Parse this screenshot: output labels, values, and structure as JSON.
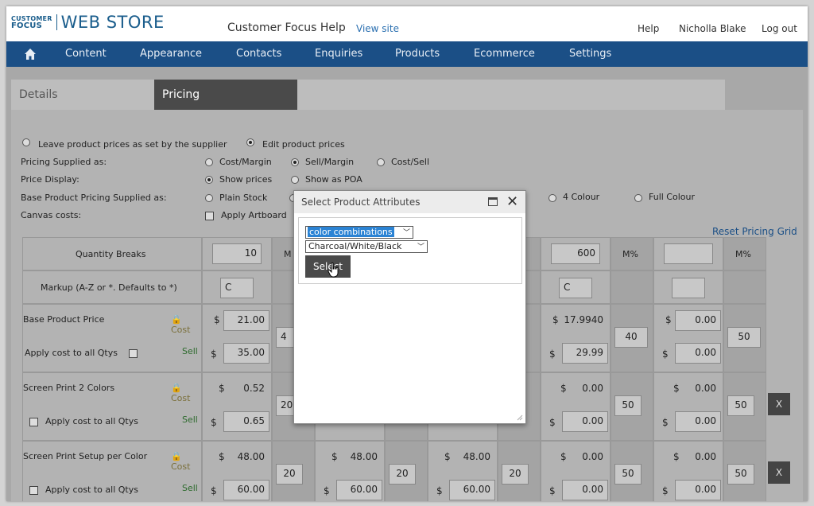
{
  "brand": {
    "small_line1": "CUSTOMER",
    "small_line2": "FOCUS",
    "big": "WEB STORE"
  },
  "header": {
    "help_title": "Customer Focus Help",
    "view_site": "View site",
    "help": "Help",
    "user": "Nicholla Blake",
    "logout": "Log out"
  },
  "nav": {
    "items": [
      "Content",
      "Appearance",
      "Contacts",
      "Enquiries",
      "Products",
      "Ecommerce",
      "Settings"
    ]
  },
  "tabs": {
    "details": "Details",
    "pricing": "Pricing"
  },
  "options": {
    "leave": "Leave product prices as set by the supplier",
    "edit": "Edit product prices",
    "pricing_supplied_as": "Pricing Supplied as:",
    "cost_margin": "Cost/Margin",
    "sell_margin": "Sell/Margin",
    "cost_sell": "Cost/Sell",
    "price_display": "Price Display:",
    "show_prices": "Show prices",
    "show_poa": "Show as POA",
    "base_pricing": "Base Product Pricing Supplied as:",
    "plain_stock": "Plain Stock",
    "four_colour": "4 Colour",
    "full_colour": "Full Colour",
    "canvas_costs": "Canvas costs:",
    "apply_artboard": "Apply Artboard"
  },
  "reset_grid": "Reset Pricing Grid",
  "grid": {
    "quantity_breaks": "Quantity Breaks",
    "markup": "Markup (A-Z or *. Defaults to *)",
    "m_pct": "M%",
    "m_partial": "M",
    "cost": "Cost",
    "sell": "Sell",
    "dollar": "$",
    "col1": {
      "qty": "10",
      "markup": "C",
      "base_cost": "21.00",
      "base_sell": "35.00",
      "sp2_cost": "0.52",
      "sp2_sell": "0.65",
      "setup_cost": "48.00",
      "setup_sell": "60.00",
      "m_base": "4",
      "m_sp2": "20",
      "m_setup": "20"
    },
    "col2": {
      "setup_cost": "48.00",
      "setup_sell": "60.00",
      "m_setup": "20"
    },
    "col3": {
      "setup_cost": "48.00",
      "setup_sell": "60.00",
      "m_setup": "20"
    },
    "col4": {
      "qty": "600",
      "markup": "C",
      "base_cost": "17.9940",
      "base_sell": "29.99",
      "sp2_cost": "0.00",
      "sp2_sell": "0.00",
      "setup_cost": "0.00",
      "setup_sell": "0.00",
      "m_base": "40",
      "m_sp2": "50",
      "m_setup": "50"
    },
    "col5": {
      "qty": "",
      "markup": "",
      "base_cost": "0.00",
      "base_sell": "0.00",
      "sp2_cost": "0.00",
      "sp2_sell": "0.00",
      "setup_cost": "0.00",
      "setup_sell": "0.00",
      "m_base": "50",
      "m_sp2": "50",
      "m_setup": "50"
    },
    "base_product_price": "Base Product Price",
    "apply_cost_all": "Apply cost to all Qtys",
    "screen_print_2": "Screen Print 2 Colors",
    "screen_print_setup": "Screen Print Setup per Color",
    "remove": "X"
  },
  "modal": {
    "title": "Select Product Attributes",
    "attribute_selected": "color combinations",
    "value_selected": "Charcoal/White/Black",
    "select_button": "Select"
  }
}
